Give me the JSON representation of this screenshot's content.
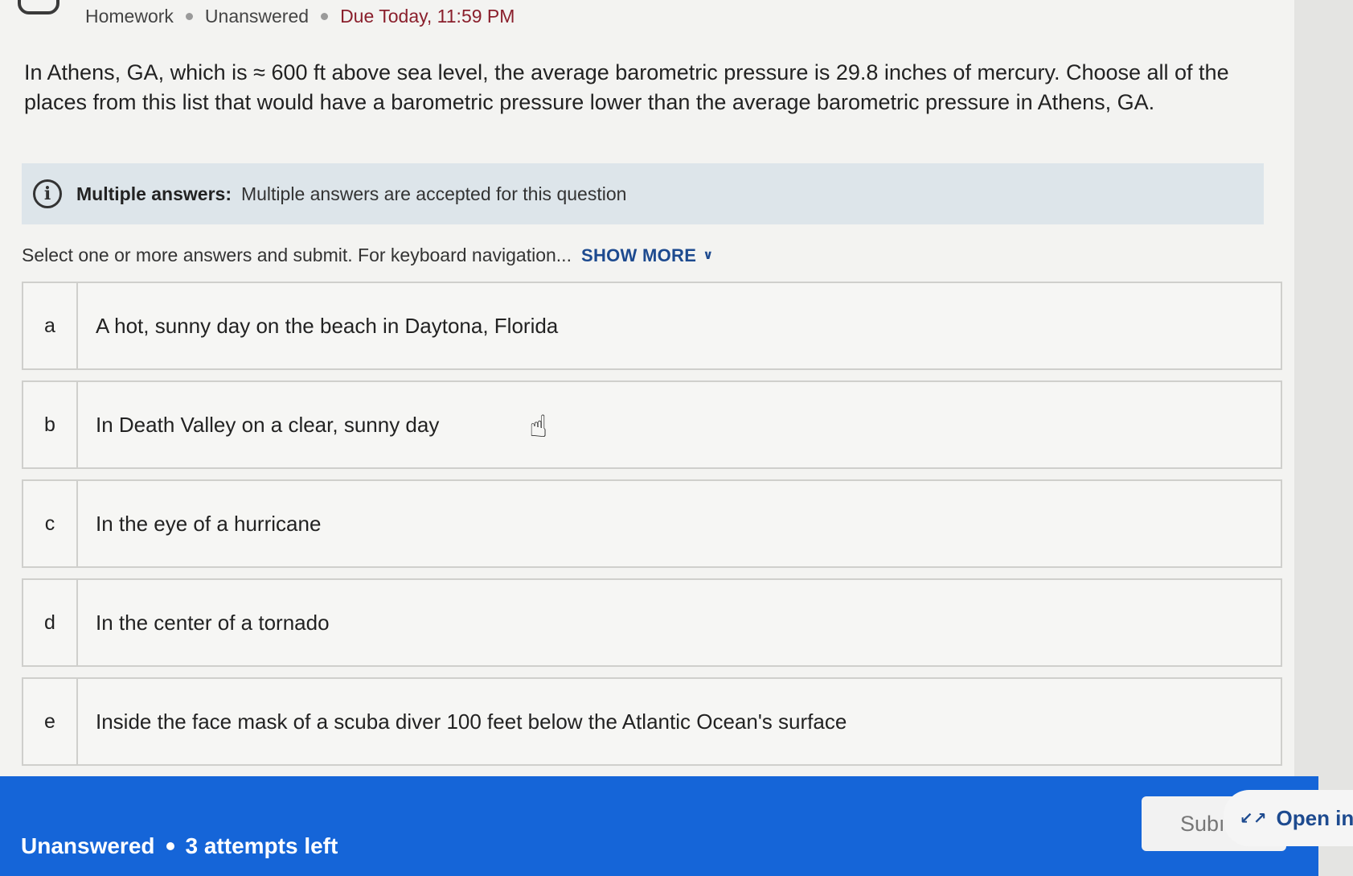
{
  "breadcrumb": {
    "section": "Homework",
    "status": "Unanswered",
    "due": "Due Today, 11:59 PM"
  },
  "question": {
    "text": "In Athens, GA, which is ≈ 600 ft above sea level, the average barometric pressure is 29.8 inches of mercury. Choose all of the places from this list that would have a barometric pressure lower than the average barometric pressure in Athens, GA."
  },
  "info": {
    "icon": "info-icon",
    "title": "Multiple answers:",
    "text": "Multiple answers are accepted for this question"
  },
  "instructions": {
    "text": "Select one or more answers and submit. For keyboard navigation...",
    "show_more": "SHOW MORE"
  },
  "options": [
    {
      "letter": "a",
      "text": "A hot, sunny day on the beach in Daytona, Florida"
    },
    {
      "letter": "b",
      "text": "In Death Valley on a clear, sunny day"
    },
    {
      "letter": "c",
      "text": "In the eye of a hurricane"
    },
    {
      "letter": "d",
      "text": "In the center of a tornado"
    },
    {
      "letter": "e",
      "text": "Inside the face mask of a scuba diver 100 feet below the Atlantic Ocean's surface"
    }
  ],
  "footer": {
    "status": "Unanswered",
    "attempts": "3 attempts left",
    "submit_label": "Subı",
    "open_in_label": "Open in I"
  },
  "colors": {
    "footer_bg": "#1565d8",
    "due_text": "#8a1f2c",
    "link": "#1d4a8f"
  }
}
